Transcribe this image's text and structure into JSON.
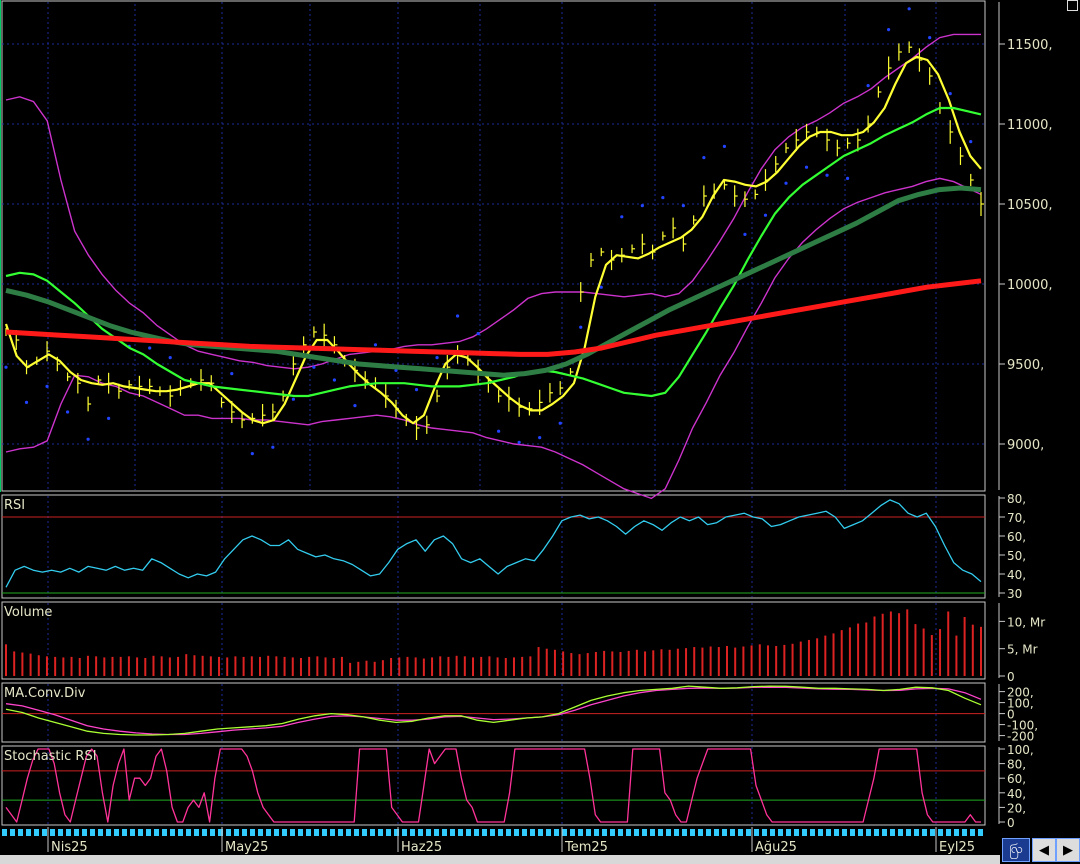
{
  "colors": {
    "background": "#000000",
    "grid": "#1a2b9a",
    "price_bars": "#ffff33",
    "ma_fast": "#ffff33",
    "ma_mid": "#33ff33",
    "ma_long": "#2e7d45",
    "ma_slow": "#ff1a1a",
    "bollinger": "#cc33cc",
    "sar": "#2244ff",
    "rsi_line": "#33ccee",
    "volume_bars": "#dd2222",
    "macd": "#aaff33",
    "macd_signal": "#ff44cc",
    "stoch": "#ff3399",
    "axis_text": "#e6e6c8",
    "scroll_ticks": "#33ccff"
  },
  "icons": [
    "bloomberg-style-logo-icon",
    "scroll-left-icon",
    "scroll-right-icon"
  ],
  "chart_data": [
    {
      "type": "line",
      "name": "price-panel",
      "y_ticks": [
        "11500,",
        "11000,",
        "10500,",
        "10000,",
        "9500,",
        "9000,"
      ],
      "ylim": [
        8750,
        11750
      ],
      "x_labels": [
        "Nis25",
        "May25",
        "Haz25",
        "Tem25",
        "Ağu25",
        "Eyl25"
      ],
      "series": [
        {
          "key": "close",
          "style": "ohlc-bars",
          "values": [
            9700,
            9650,
            9480,
            9520,
            9580,
            9500,
            9420,
            9380,
            9250,
            9400,
            9380,
            9330,
            9370,
            9360,
            9360,
            9330,
            9300,
            9350,
            9380,
            9400,
            9380,
            9260,
            9200,
            9150,
            9160,
            9180,
            9200,
            9300,
            9500,
            9620,
            9700,
            9680,
            9620,
            9520,
            9460,
            9400,
            9380,
            9300,
            9220,
            9150,
            9100,
            9120,
            9300,
            9480,
            9560,
            9530,
            9450,
            9380,
            9300,
            9280,
            9230,
            9220,
            9260,
            9320,
            9350,
            9450,
            9950,
            10150,
            10200,
            10150,
            10180,
            10220,
            10250,
            10200,
            10300,
            10350,
            10250,
            10400,
            10550,
            10580,
            10620,
            10550,
            10530,
            10560,
            10650,
            10750,
            10850,
            10900,
            10950,
            10950,
            10900,
            10850,
            10880,
            10900,
            11000,
            11200,
            11350,
            11450,
            11480,
            11400,
            11300,
            11100,
            10950,
            10800,
            10650,
            10500
          ]
        },
        {
          "key": "ma_fast",
          "name": "",
          "values": [
            9750,
            9550,
            9480,
            9520,
            9560,
            9520,
            9450,
            9400,
            9380,
            9370,
            9380,
            9360,
            9350,
            9340,
            9330,
            9330,
            9340,
            9360,
            9380,
            9380,
            9320,
            9260,
            9200,
            9150,
            9130,
            9150,
            9250,
            9400,
            9550,
            9650,
            9650,
            9580,
            9500,
            9430,
            9370,
            9320,
            9260,
            9180,
            9130,
            9180,
            9350,
            9500,
            9560,
            9540,
            9480,
            9410,
            9350,
            9290,
            9240,
            9210,
            9210,
            9250,
            9300,
            9380,
            9600,
            9920,
            10120,
            10180,
            10170,
            10160,
            10190,
            10230,
            10260,
            10290,
            10340,
            10420,
            10550,
            10650,
            10640,
            10620,
            10610,
            10640,
            10700,
            10780,
            10860,
            10920,
            10950,
            10950,
            10930,
            10930,
            10950,
            11010,
            11100,
            11250,
            11380,
            11420,
            11400,
            11310,
            11150,
            10950,
            10800,
            10720
          ]
        },
        {
          "key": "ma_mid",
          "name": "",
          "values": [
            10050,
            10070,
            10060,
            10020,
            9950,
            9880,
            9800,
            9720,
            9660,
            9600,
            9560,
            9500,
            9450,
            9400,
            9380,
            9360,
            9350,
            9340,
            9330,
            9320,
            9310,
            9300,
            9300,
            9320,
            9340,
            9360,
            9370,
            9380,
            9380,
            9380,
            9370,
            9360,
            9360,
            9360,
            9370,
            9380,
            9400,
            9420,
            9450,
            9460,
            9450,
            9430,
            9410,
            9380,
            9350,
            9320,
            9310,
            9300,
            9320,
            9420,
            9560,
            9700,
            9850,
            9990,
            10150,
            10300,
            10440,
            10540,
            10620,
            10680,
            10740,
            10800,
            10840,
            10880,
            10930,
            10970,
            11010,
            11060,
            11100,
            11100,
            11080,
            11060
          ]
        },
        {
          "key": "ma_long",
          "name": "",
          "values": [
            9960,
            9930,
            9890,
            9840,
            9790,
            9740,
            9700,
            9670,
            9640,
            9620,
            9610,
            9600,
            9590,
            9580,
            9560,
            9540,
            9520,
            9500,
            9490,
            9480,
            9470,
            9460,
            9450,
            9440,
            9430,
            9440,
            9460,
            9500,
            9560,
            9630,
            9700,
            9770,
            9840,
            9900,
            9960,
            10020,
            10080,
            10140,
            10200,
            10260,
            10320,
            10380,
            10450,
            10520,
            10560,
            10590,
            10600,
            10590
          ]
        },
        {
          "key": "ma_slow",
          "name": "",
          "values": [
            9700,
            9690,
            9680,
            9670,
            9660,
            9650,
            9640,
            9630,
            9620,
            9610,
            9605,
            9600,
            9595,
            9590,
            9585,
            9580,
            9575,
            9570,
            9565,
            9560,
            9560,
            9575,
            9600,
            9640,
            9680,
            9710,
            9740,
            9770,
            9800,
            9830,
            9860,
            9890,
            9920,
            9950,
            9980,
            10000,
            10020
          ]
        }
      ]
    },
    {
      "type": "line",
      "name": "RSI",
      "ylim": [
        30,
        80
      ],
      "y_ticks": [
        "80,",
        "70,",
        "60,",
        "50,",
        "40,",
        "30"
      ],
      "series": [
        {
          "key": "rsi",
          "values": [
            33,
            42,
            44,
            42,
            41,
            42,
            41,
            43,
            41,
            44,
            43,
            42,
            44,
            42,
            43,
            42,
            48,
            46,
            43,
            40,
            38,
            40,
            39,
            41,
            48,
            53,
            58,
            60,
            58,
            55,
            55,
            58,
            53,
            51,
            49,
            50,
            48,
            47,
            45,
            42,
            39,
            40,
            46,
            53,
            56,
            58,
            52,
            58,
            60,
            56,
            48,
            46,
            48,
            44,
            40,
            44,
            46,
            48,
            47,
            53,
            60,
            68,
            70,
            71,
            69,
            70,
            68,
            65,
            61,
            65,
            68,
            66,
            63,
            67,
            70,
            68,
            70,
            66,
            67,
            70,
            71,
            72,
            70,
            69,
            65,
            66,
            68,
            70,
            71,
            72,
            73,
            70,
            64,
            66,
            68,
            72,
            76,
            79,
            77,
            72,
            70,
            72,
            65,
            55,
            46,
            42,
            40,
            36
          ]
        }
      ]
    },
    {
      "type": "bar",
      "name": "Volume",
      "ylim": [
        0,
        13
      ],
      "y_ticks": [
        "10, Mr",
        "5, Mr",
        "0"
      ],
      "series": [
        {
          "key": "volume",
          "values": [
            5.8,
            4.5,
            4.3,
            4.1,
            3.8,
            3.6,
            3.5,
            3.4,
            3.5,
            3.3,
            3.7,
            3.6,
            3.4,
            3.5,
            3.5,
            3.6,
            3.4,
            3.3,
            3.7,
            3.6,
            3.4,
            3.5,
            4.0,
            3.8,
            3.7,
            3.6,
            3.5,
            3.4,
            3.6,
            3.5,
            3.6,
            3.5,
            3.7,
            3.6,
            3.5,
            3.4,
            3.3,
            3.5,
            3.6,
            3.4,
            3.3,
            3.5,
            2.4,
            2.6,
            2.8,
            2.6,
            2.9,
            3.3,
            3.4,
            3.5,
            3.4,
            3.2,
            3.4,
            3.6,
            3.5,
            3.7,
            3.6,
            3.4,
            3.5,
            3.6,
            3.4,
            3.3,
            3.4,
            3.5,
            3.6,
            5.3,
            5.0,
            4.8,
            4.5,
            4.2,
            4.0,
            4.2,
            4.4,
            4.6,
            4.5,
            4.4,
            4.6,
            4.8,
            4.5,
            4.7,
            4.9,
            4.8,
            5.0,
            5.1,
            5.3,
            5.2,
            5.4,
            5.3,
            5.5,
            5.2,
            5.4,
            5.6,
            5.8,
            5.6,
            5.5,
            5.7,
            5.9,
            6.3,
            6.6,
            6.9,
            7.4,
            7.8,
            8.4,
            8.9,
            9.6,
            9.8,
            10.9,
            11.4,
            11.8,
            11.5,
            12.2,
            9.5,
            8.7,
            7.5,
            8.6,
            11.8,
            7.4,
            10.8,
            9.4,
            9.0
          ]
        }
      ]
    },
    {
      "type": "line",
      "name": "MA.Conv.Div",
      "ylim": [
        -240,
        260
      ],
      "y_ticks": [
        "200,",
        "100,",
        "0",
        "-100,",
        "-200"
      ],
      "series": [
        {
          "key": "macd",
          "values": [
            40,
            10,
            -40,
            -80,
            -120,
            -160,
            -180,
            -190,
            -195,
            -195,
            -190,
            -180,
            -160,
            -140,
            -130,
            -120,
            -110,
            -90,
            -50,
            -20,
            0,
            -10,
            -30,
            -60,
            -80,
            -70,
            -40,
            -20,
            -20,
            -60,
            -80,
            -60,
            -40,
            -30,
            0,
            60,
            120,
            160,
            190,
            210,
            220,
            230,
            250,
            240,
            230,
            235,
            245,
            250,
            248,
            240,
            230,
            230,
            225,
            220,
            210,
            220,
            240,
            235,
            210,
            140,
            80
          ]
        },
        {
          "key": "macd_signal",
          "values": [
            90,
            70,
            30,
            -10,
            -60,
            -110,
            -140,
            -160,
            -175,
            -185,
            -190,
            -190,
            -180,
            -165,
            -150,
            -140,
            -130,
            -115,
            -80,
            -50,
            -25,
            -20,
            -30,
            -45,
            -60,
            -60,
            -50,
            -30,
            -25,
            -40,
            -55,
            -50,
            -40,
            -30,
            -10,
            30,
            80,
            120,
            160,
            190,
            210,
            220,
            230,
            232,
            230,
            232,
            238,
            240,
            238,
            232,
            225,
            222,
            220,
            215,
            210,
            212,
            225,
            230,
            225,
            190,
            130
          ]
        }
      ]
    },
    {
      "type": "line",
      "name": "Stochastic RSI",
      "ylim": [
        0,
        100
      ],
      "y_ticks": [
        "100,",
        "80,",
        "60,",
        "40,",
        "20,",
        "0"
      ],
      "series": [
        {
          "key": "stoch",
          "values": [
            20,
            10,
            0,
            30,
            60,
            85,
            100,
            100,
            100,
            80,
            40,
            10,
            0,
            30,
            60,
            90,
            100,
            90,
            40,
            0,
            50,
            80,
            100,
            30,
            60,
            60,
            50,
            60,
            90,
            100,
            70,
            20,
            0,
            0,
            20,
            30,
            20,
            40,
            0,
            60,
            100,
            100,
            100,
            100,
            100,
            90,
            70,
            40,
            20,
            10,
            0,
            0,
            0,
            0,
            0,
            0,
            0,
            0,
            0,
            0,
            0,
            0,
            0,
            0,
            0,
            0,
            100,
            100,
            100,
            100,
            100,
            100,
            20,
            10,
            0,
            0,
            0,
            0,
            50,
            100,
            80,
            90,
            100,
            100,
            100,
            60,
            30,
            20,
            0,
            0,
            0,
            0,
            0,
            0,
            40,
            100,
            100,
            100,
            100,
            100,
            100,
            100,
            100,
            100,
            100,
            100,
            100,
            100,
            100,
            60,
            10,
            0,
            0,
            0,
            0,
            0,
            0,
            100,
            100,
            100,
            100,
            100,
            100,
            40,
            30,
            10,
            0,
            0,
            30,
            60,
            80,
            100,
            100,
            100,
            100,
            100,
            100,
            100,
            100,
            100,
            50,
            30,
            10,
            0,
            0,
            0,
            0,
            0,
            0,
            0,
            0,
            0,
            0,
            0,
            0,
            0,
            0,
            0,
            0,
            0,
            0,
            30,
            60,
            100,
            100,
            100,
            100,
            100,
            100,
            100,
            100,
            40,
            10,
            0,
            0,
            0,
            0,
            0,
            0,
            0,
            10,
            0,
            0
          ]
        }
      ]
    }
  ],
  "panels": [
    {
      "title": "RSI"
    },
    {
      "title": "Volume"
    },
    {
      "title": "MA.Conv.Div"
    },
    {
      "title": "Stochastic RSI"
    }
  ]
}
